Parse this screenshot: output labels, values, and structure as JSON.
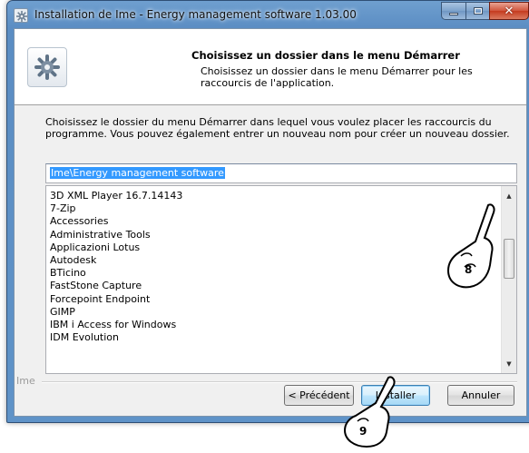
{
  "window": {
    "title": "Installation de Ime - Energy management software 1.03.00"
  },
  "header": {
    "title": "Choisissez un dossier dans le menu Démarrer",
    "description": "Choisissez un dossier dans le menu Démarrer pour les raccourcis de l'application."
  },
  "main": {
    "instructions": "Choisissez le dossier du menu Démarrer dans lequel vous voulez placer les raccourcis du programme. Vous pouvez également entrer un nouveau nom pour créer un nouveau dossier.",
    "folder_value": "Ime\\Energy management software",
    "folder_list": [
      "3D XML Player 16.7.14143",
      "7-Zip",
      "Accessories",
      "Administrative Tools",
      "Applicazioni Lotus",
      "Autodesk",
      "BTicino",
      "FastStone Capture",
      "Forcepoint Endpoint",
      "GIMP",
      "IBM i Access for Windows",
      "IDM Evolution"
    ]
  },
  "footer": {
    "brand": "Ime",
    "back_label": "< Précédent",
    "install_label": "Installer",
    "cancel_label": "Annuler"
  },
  "annotations": {
    "step_scroll": "8",
    "step_install": "9"
  }
}
